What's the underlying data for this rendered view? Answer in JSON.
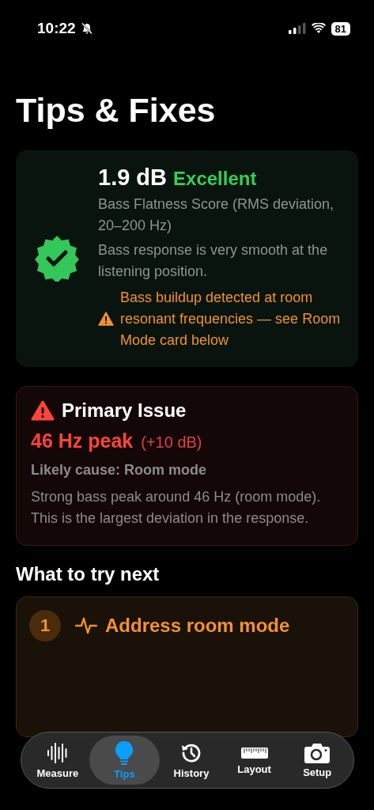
{
  "status_bar": {
    "time": "10:22",
    "silent": true,
    "battery": "81"
  },
  "title": "Tips & Fixes",
  "score_card": {
    "value": "1.9 dB",
    "rating": "Excellent",
    "label": "Bass Flatness Score (RMS deviation, 20–200 Hz)",
    "summary": "Bass response is very smooth at the listening position.",
    "warning": "Bass buildup detected at room resonant frequencies — see Room Mode card below"
  },
  "primary_issue": {
    "heading": "Primary Issue",
    "peak": "46 Hz peak",
    "delta": "(+10 dB)",
    "cause": "Likely cause: Room mode",
    "description": "Strong bass peak around 46 Hz (room mode). This is the largest deviation in the response."
  },
  "next_heading": "What to try next",
  "steps": [
    {
      "number": "1",
      "title": "Address room mode"
    }
  ],
  "tabs": [
    {
      "label": "Measure",
      "kind": "wave",
      "selected": false
    },
    {
      "label": "Tips",
      "kind": "bulb",
      "selected": true
    },
    {
      "label": "History",
      "kind": "history",
      "selected": false
    },
    {
      "label": "Layout",
      "kind": "ruler",
      "selected": false
    },
    {
      "label": "Setup",
      "kind": "camera",
      "selected": false
    }
  ]
}
